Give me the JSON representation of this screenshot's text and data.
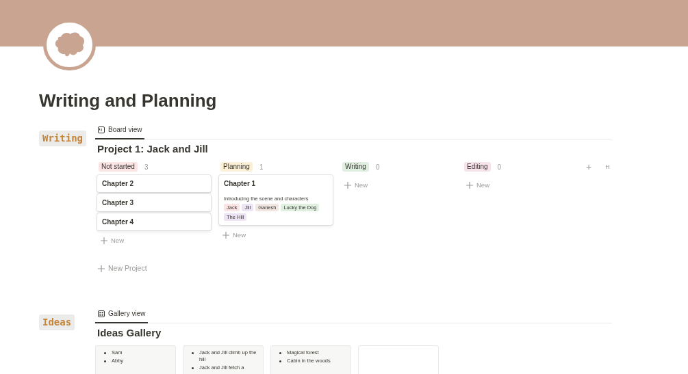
{
  "page": {
    "title": "Writing and Planning"
  },
  "writing": {
    "label": "Writing",
    "view_tab": {
      "label": "Board view",
      "selected": true
    },
    "board_title": "Project 1: Jack and Jill",
    "columns": [
      {
        "status": "Not started",
        "color": "#fbe4e4",
        "count": "3",
        "cards": [
          {
            "title": "Chapter 2"
          },
          {
            "title": "Chapter 3"
          },
          {
            "title": "Chapter 4"
          }
        ],
        "new_label": "New"
      },
      {
        "status": "Planning",
        "color": "#fbf0d6",
        "count": "1",
        "cards": [
          {
            "title": "Chapter 1",
            "description": "Introducing the scene and characters",
            "tags": [
              {
                "label": "Jack",
                "color": "#fbe4e4"
              },
              {
                "label": "Jill",
                "color": "#ece4f5"
              },
              {
                "label": "Ganesh",
                "color": "#f1e6e2"
              },
              {
                "label": "Lucky the Dog",
                "color": "#e1efe1"
              },
              {
                "label": "The Hill",
                "color": "#ece4f5"
              }
            ]
          }
        ],
        "new_label": "New"
      },
      {
        "status": "Writing",
        "color": "#e1efe1",
        "count": "0",
        "new_label": "New"
      },
      {
        "status": "Editing",
        "color": "#f7e3ec",
        "count": "0",
        "new_label": "New"
      }
    ],
    "add_group": "+",
    "hidden_column_label": "H",
    "new_project": "New Project"
  },
  "ideas": {
    "label": "Ideas",
    "view_tab": {
      "label": "Gallery view",
      "selected": true
    },
    "gallery_title": "Ideas Gallery",
    "cards": [
      {
        "kind": "list",
        "items": [
          "Sam",
          "Abby"
        ]
      },
      {
        "kind": "list",
        "items": [
          "Jack and Jill climb up the hill",
          "Jack and Jill fetch a"
        ]
      },
      {
        "kind": "list",
        "items": [
          "Magical forest",
          "Cabin in the woods"
        ]
      },
      {
        "kind": "blank"
      }
    ]
  }
}
